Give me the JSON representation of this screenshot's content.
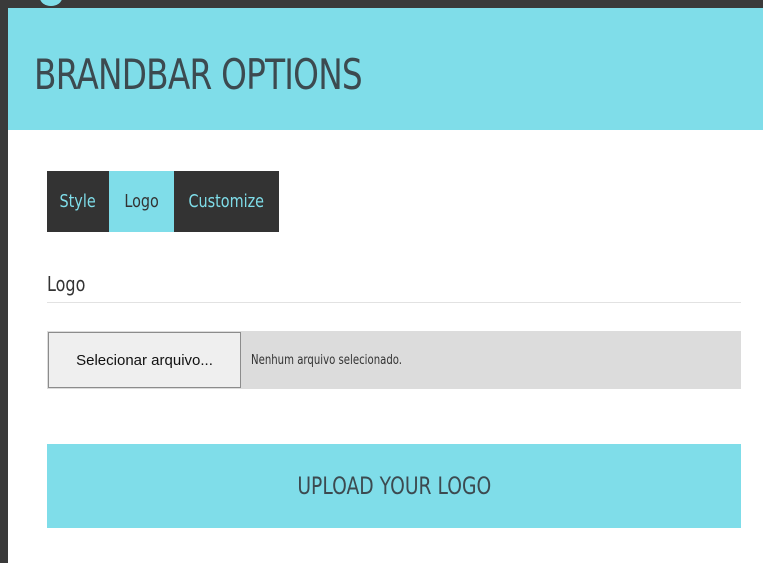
{
  "header": {
    "title": "BRANDBAR OPTIONS"
  },
  "tabs": [
    {
      "label": "Style",
      "active": false
    },
    {
      "label": "Logo",
      "active": true
    },
    {
      "label": "Customize",
      "active": false
    }
  ],
  "logo_section": {
    "heading": "Logo",
    "file_button_label": "Selecionar arquivo...",
    "file_status": "Nenhum arquivo selecionado.",
    "upload_label": "UPLOAD YOUR LOGO"
  },
  "colors": {
    "accent": "#7fdde9",
    "dark": "#333333",
    "frame": "#3a3a3a"
  }
}
